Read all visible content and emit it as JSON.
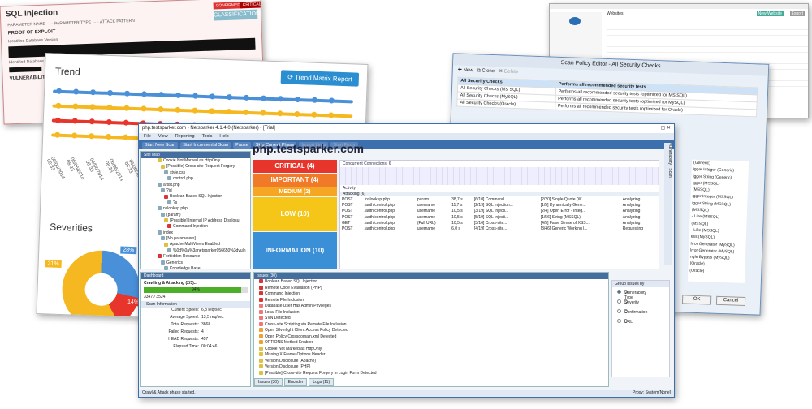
{
  "sql_report": {
    "title": "SQL Injection",
    "badge_confirmed": "CONFIRMED",
    "badge_critical": "CRITICAL",
    "classification": "CLASSIFICATION",
    "proof": "PROOF OF EXPLOIT",
    "db1": "Identified Database Version",
    "db2": "Identified Database Name",
    "vuln": "VULNERABILITY DETAILS"
  },
  "trend": {
    "title": "Trend",
    "button": "Trend Matrix Report",
    "severities": "Severities",
    "pie_labels": [
      "31%",
      "28%",
      "14%"
    ],
    "lines": [
      {
        "color": "#4a90d9"
      },
      {
        "color": "#f5b820"
      },
      {
        "color": "#e8352b"
      },
      {
        "color": "#f5b820"
      }
    ],
    "dates": [
      "06/06/2014 08:33",
      "06/06/2014 08:33",
      "06/06/2014 08:33",
      "06/06/2014 08:33",
      "06/06/2014 08:33",
      "06/10/2014 08:10"
    ]
  },
  "web": {
    "websites": "Websites",
    "new_website": "New Website",
    "export": "Export",
    "rows": 12
  },
  "policy": {
    "title": "Scan Policy Editor - All Security Checks",
    "new": "New",
    "clone": "Clone",
    "delete": "Delete",
    "rows": [
      {
        "name": "All Security Checks",
        "desc": "Performs all recommended security tests"
      },
      {
        "name": "All Security Checks (MS SQL)",
        "desc": "Performs all recommended security tests (optimized for MS SQL)"
      },
      {
        "name": "All Security Checks (MySQL)",
        "desc": "Performs all recommended security tests (optimized for MySQL)"
      },
      {
        "name": "All Security Checks (Oracle)",
        "desc": "Performs all recommended security tests (optimized for Oracle)"
      }
    ],
    "list": [
      "(Generic)",
      "igger Integer (Generic)",
      "igger String (Generic)",
      "igger (MSSQL)",
      "(MSSQL)",
      "igger Integer (MSSQL)",
      "igger String (MSSQL)",
      "(MSSQL)",
      "- Like (MSSQL)",
      "(MSSQL)",
      "- Like (MSSQL)",
      "ess (MySQL)",
      "lrror Generator (MySQL)",
      "lrror Generator (MySQL)",
      "ngle Bypass (MySQL)",
      "(Oracle)",
      "(Oracle)"
    ],
    "ok": "OK",
    "cancel": "Cancel"
  },
  "main": {
    "title": "php.testsparker.com - Netsparker 4.1.4.0 (Netsparker) - [Trial]",
    "menu": [
      "File",
      "View",
      "Reporting",
      "Tools",
      "Help"
    ],
    "toolbar": [
      "Start New Scan",
      "Start Incremental Scan",
      "Pause",
      "Skip Current Phase",
      "Import Links",
      "Start Proxy"
    ],
    "sitemap_title": "Site Map",
    "sitemap": [
      "Cookie Not Marked as HttpOnly",
      "[Possible] Cross-site Request Forgery",
      "style.css",
      "control.php",
      "artist.php",
      "?id",
      "Boolean Based SQL Injection",
      "?s",
      "nslookup.php",
      "(param)",
      "[Possible] Internal IP Address Disclosu",
      "Command Injection",
      "index",
      "[No parameters]",
      "Apache MultiViews Enabled",
      "%0d%0a%3anetsparker056650%3dvuln",
      "Forbidden Resource",
      "Generics",
      "Knowledge Base"
    ],
    "host": "php.testsparker.com",
    "severity": {
      "critical": "CRITICAL (4)",
      "important": "IMPORTANT (4)",
      "medium": "MEDIUM (2)",
      "low": "LOW (10)",
      "information": "INFORMATION (10)"
    },
    "concurrent": "Concurrent Connections: 6",
    "activity": "Activity",
    "attacking": "Attacking (6)",
    "activity_rows": [
      [
        "POST",
        "/nslookup.php",
        "param",
        "38,7 s",
        "[6/10] Command...",
        "[2/20] Single Quote (W...",
        "Analyzing"
      ],
      [
        "POST",
        "/auth/control.php",
        "username",
        "11,7 s",
        "[2/19] SQL Injection...",
        "[1/5] Dynamically Gene...",
        "Analyzing"
      ],
      [
        "POST",
        "/auth/control.php",
        "username",
        "10,5 s",
        "[3/19] SQL Injecti...",
        "[2/4] Open Error - Integ...",
        "Analyzing"
      ],
      [
        "POST",
        "/auth/control.php",
        "username",
        "10,5 s",
        "[5/19] SQL Injecti...",
        "[1/56] String (MSSQL)",
        "Analyzing"
      ],
      [
        "GET",
        "/auth/control.php",
        "(Full URL)",
        "10,5 s",
        "[3/16] Cross-site...",
        "[4/5] False Sense of XSS...",
        "Analyzing"
      ],
      [
        "POST",
        "/auth/control.php",
        "username",
        "6,0 s",
        "[4/19] Cross-site...",
        "[3/46] Generic Working l...",
        "Requesting"
      ]
    ],
    "dashboard_title": "Dashboard",
    "progress_label": "Crawling & Attacking (2/3)...",
    "progress_pct": "94%",
    "progress_value": 0.94,
    "progress_count": "3347 / 3524",
    "scan_info": "Scan Information",
    "stats": [
      [
        "Current Speed:",
        "6,8 req/sec"
      ],
      [
        "Average Speed:",
        "13,5 req/sec"
      ],
      [
        "Total Requests:",
        "3868"
      ],
      [
        "Failed Requests:",
        "4"
      ],
      [
        "HEAD Requests:",
        "457"
      ],
      [
        "Elapsed Time:",
        "00:04:46"
      ]
    ],
    "issues_title": "Issues (30)",
    "issues": [
      {
        "t": "Boolean Based SQL Injection",
        "c": "#d33"
      },
      {
        "t": "Remote Code Evaluation (PHP)",
        "c": "#d33"
      },
      {
        "t": "Command Injection",
        "c": "#d33"
      },
      {
        "t": "Remote File Inclusion",
        "c": "#d33"
      },
      {
        "t": "Database User Has Admin Privileges",
        "c": "#e77"
      },
      {
        "t": "Local File Inclusion",
        "c": "#e77"
      },
      {
        "t": "SVN Detected",
        "c": "#e77"
      },
      {
        "t": "Cross-site Scripting via Remote File Inclusion",
        "c": "#e77"
      },
      {
        "t": "Open Silverlight Client Access Policy Detected",
        "c": "#f0a030"
      },
      {
        "t": "Open Policy Crossdomain.xml Detected",
        "c": "#f0a030"
      },
      {
        "t": "OPTIONS Method Enabled",
        "c": "#f0a030"
      },
      {
        "t": "Cookie Not Marked as HttpOnly",
        "c": "#e0c040"
      },
      {
        "t": "Missing X-Frame-Options Header",
        "c": "#e0c040"
      },
      {
        "t": "Version Disclosure (Apache)",
        "c": "#e0c040"
      },
      {
        "t": "Version Disclosure (PHP)",
        "c": "#e0c040"
      },
      {
        "t": "[Possible] Cross-site Request Forgery in Login Form Detected",
        "c": "#e0c040"
      }
    ],
    "group_by": "Group Issues by",
    "group_opts": [
      "Vulnerability Type",
      "Severity",
      "Confirmation",
      "URL"
    ],
    "bottom_tabs": [
      "Issues (30)",
      "Encoder",
      "Logs (11)"
    ],
    "vertical_tabs": [
      "Vulnerability",
      "Scan"
    ],
    "status_left": "Crawl & Attack phase started.",
    "status_right": "Proxy: System[None]"
  }
}
